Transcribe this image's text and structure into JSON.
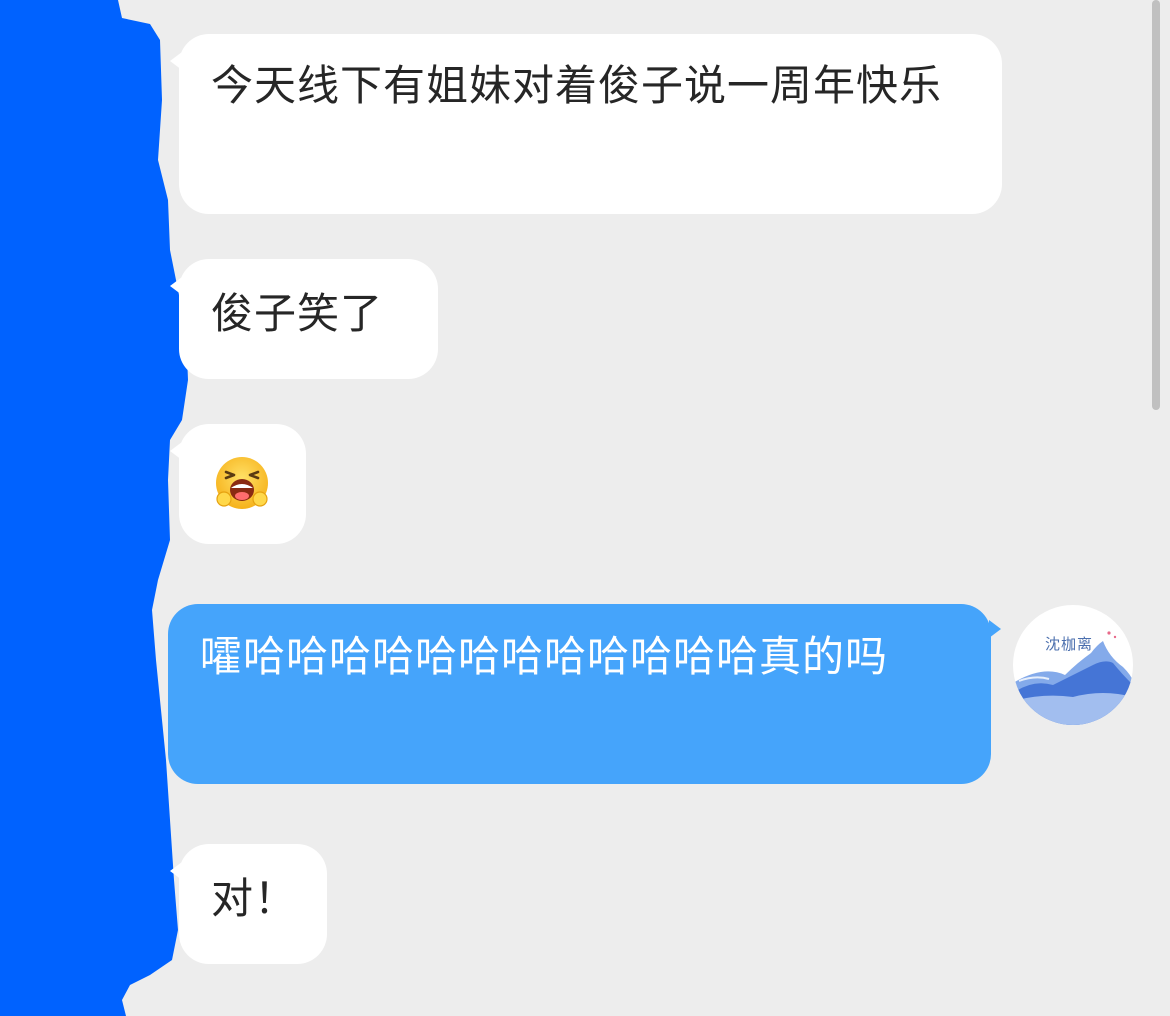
{
  "conversation": {
    "messages": [
      {
        "sender": "other",
        "text": "今天线下有姐妹对着俊子说一周年快乐"
      },
      {
        "sender": "other",
        "text": "俊子笑了"
      },
      {
        "sender": "other",
        "emoji": "😫"
      },
      {
        "sender": "me",
        "text": "嚯哈哈哈哈哈哈哈哈哈哈哈哈真的吗"
      },
      {
        "sender": "other",
        "text": "对！"
      }
    ]
  },
  "me_avatar": {
    "label": "沈枷离"
  },
  "colors": {
    "background": "#ededed",
    "incoming_bubble": "#ffffff",
    "outgoing_bubble": "#45a4fb",
    "redaction": "#0062ff"
  }
}
